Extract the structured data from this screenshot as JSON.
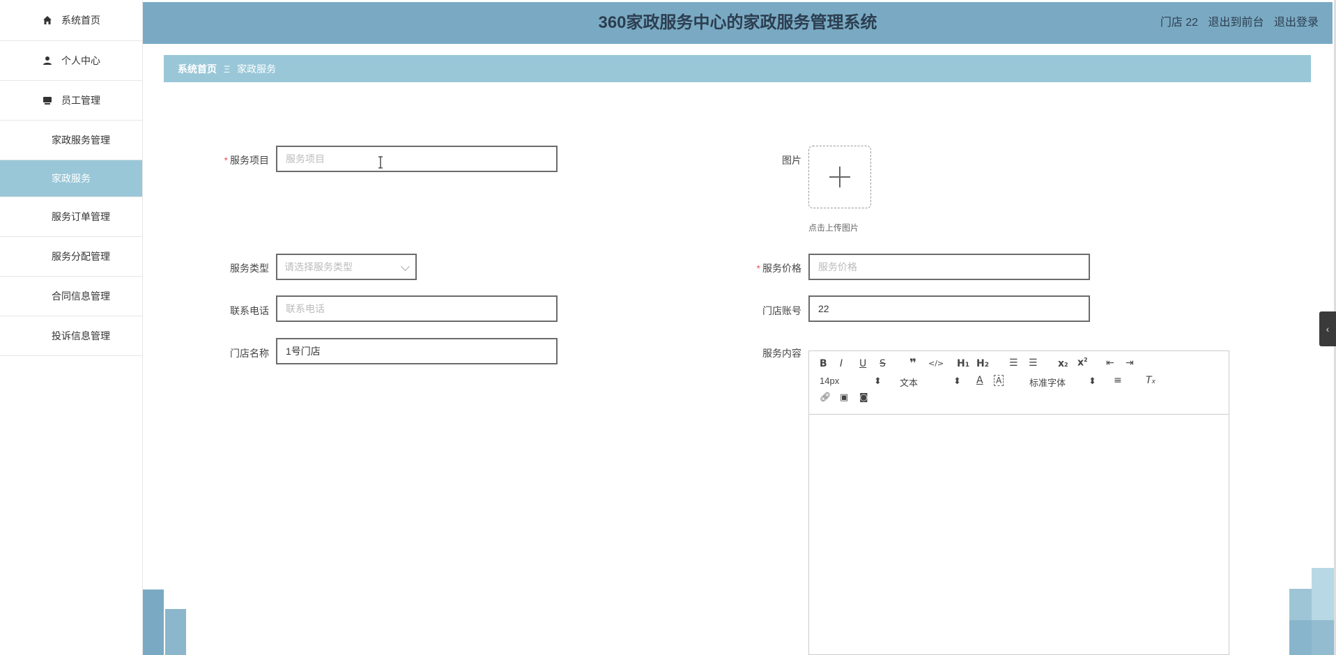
{
  "sidebar": {
    "items": [
      {
        "label": "系统首页",
        "icon": "home-icon"
      },
      {
        "label": "个人中心",
        "icon": "user-icon"
      },
      {
        "label": "员工管理",
        "icon": "monitor-icon"
      },
      {
        "label": "家政服务管理",
        "icon": "grid-icon"
      },
      {
        "label": "家政服务",
        "sub": true
      },
      {
        "label": "服务订单管理",
        "icon": "grid-icon"
      },
      {
        "label": "服务分配管理",
        "icon": "grid-icon"
      },
      {
        "label": "合同信息管理",
        "icon": "grid-icon"
      },
      {
        "label": "投诉信息管理",
        "icon": "grid-icon"
      }
    ]
  },
  "header": {
    "title": "360家政服务中心的家政服务管理系统",
    "user": "门店 22",
    "front": "退出到前台",
    "logout": "退出登录"
  },
  "breadcrumb": {
    "home": "系统首页",
    "separator": "Ξ",
    "current": "家政服务"
  },
  "form": {
    "service_item": {
      "label": "服务项目",
      "placeholder": "服务项目",
      "value": ""
    },
    "image": {
      "label": "图片",
      "tip": "点击上传图片"
    },
    "service_type": {
      "label": "服务类型",
      "placeholder": "请选择服务类型"
    },
    "service_price": {
      "label": "服务价格",
      "placeholder": "服务价格",
      "value": ""
    },
    "phone": {
      "label": "联系电话",
      "placeholder": "联系电话",
      "value": ""
    },
    "store_account": {
      "label": "门店账号",
      "value": "22"
    },
    "store_name": {
      "label": "门店名称",
      "value": "1号门店"
    },
    "content": {
      "label": "服务内容"
    }
  },
  "editor": {
    "font_size": "14px",
    "heading": "文本",
    "font_family": "标准字体"
  },
  "colors": {
    "header": "#7aaac3",
    "crumb": "#99c7d8",
    "active_sub": "#99c7d8"
  }
}
